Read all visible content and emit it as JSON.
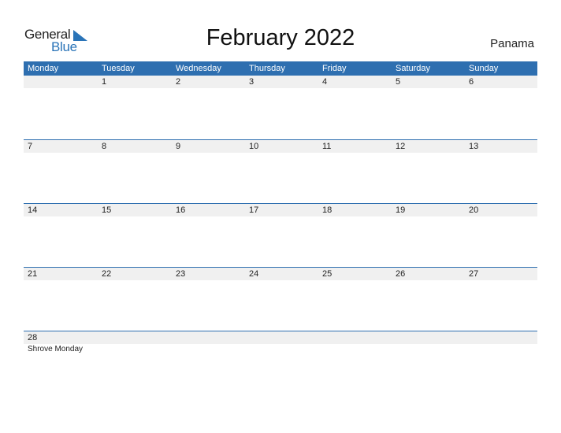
{
  "logo": {
    "general": "General",
    "blue": "Blue",
    "accent": "#2a74b8"
  },
  "title": "February 2022",
  "country": "Panama",
  "colors": {
    "header_bg": "#2e6fb0",
    "day_strip": "#f0f0f0"
  },
  "weekdays": [
    "Monday",
    "Tuesday",
    "Wednesday",
    "Thursday",
    "Friday",
    "Saturday",
    "Sunday"
  ],
  "weeks": [
    {
      "days": [
        "",
        "1",
        "2",
        "3",
        "4",
        "5",
        "6"
      ],
      "events": [
        "",
        "",
        "",
        "",
        "",
        "",
        ""
      ]
    },
    {
      "days": [
        "7",
        "8",
        "9",
        "10",
        "11",
        "12",
        "13"
      ],
      "events": [
        "",
        "",
        "",
        "",
        "",
        "",
        ""
      ]
    },
    {
      "days": [
        "14",
        "15",
        "16",
        "17",
        "18",
        "19",
        "20"
      ],
      "events": [
        "",
        "",
        "",
        "",
        "",
        "",
        ""
      ]
    },
    {
      "days": [
        "21",
        "22",
        "23",
        "24",
        "25",
        "26",
        "27"
      ],
      "events": [
        "",
        "",
        "",
        "",
        "",
        "",
        ""
      ]
    },
    {
      "days": [
        "28",
        "",
        "",
        "",
        "",
        "",
        ""
      ],
      "events": [
        "Shrove Monday",
        "",
        "",
        "",
        "",
        "",
        ""
      ]
    }
  ]
}
